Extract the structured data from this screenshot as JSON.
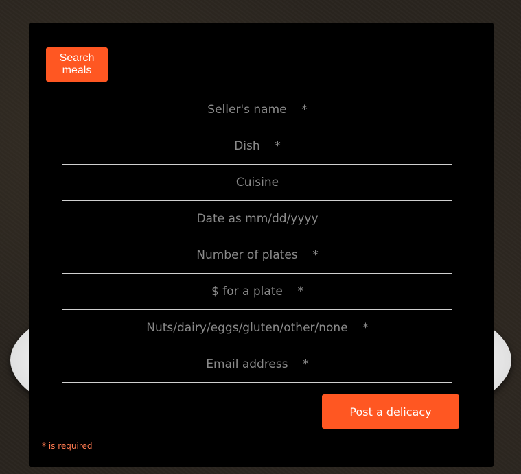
{
  "colors": {
    "accent": "#ff5722",
    "panel_background": "#000000",
    "required_note": "#ff7a50"
  },
  "toolbar": {
    "search_label": "Search meals"
  },
  "form": {
    "fields": [
      {
        "placeholder": "Seller's name    *",
        "value": ""
      },
      {
        "placeholder": "Dish    *",
        "value": ""
      },
      {
        "placeholder": "Cuisine",
        "value": ""
      },
      {
        "placeholder": "Date as mm/dd/yyyy",
        "value": ""
      },
      {
        "placeholder": "Number of plates    *",
        "value": ""
      },
      {
        "placeholder": "$ for a plate    *",
        "value": ""
      },
      {
        "placeholder": "Nuts/dairy/eggs/gluten/other/none    *",
        "value": ""
      },
      {
        "placeholder": "Email address    *",
        "value": ""
      }
    ],
    "submit_label": "Post a delicacy",
    "required_note": "* is required"
  }
}
